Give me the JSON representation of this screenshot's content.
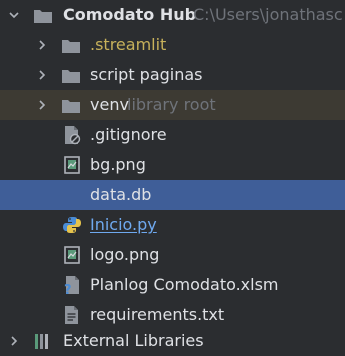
{
  "tree": {
    "root": {
      "name": "Comodato Hub",
      "path": "C:\\Users\\jonathasc"
    },
    "items": [
      {
        "label": ".streamlit",
        "icon": "folder-icon"
      },
      {
        "label": "script paginas",
        "icon": "folder-icon"
      },
      {
        "label": "venv",
        "hint": "library root",
        "icon": "folder-icon"
      },
      {
        "label": ".gitignore",
        "icon": "ignored-file-icon"
      },
      {
        "label": "bg.png",
        "icon": "image-file-icon"
      },
      {
        "label": "data.db",
        "icon": ""
      },
      {
        "label": "Inicio.py",
        "icon": "python-file-icon"
      },
      {
        "label": "logo.png",
        "icon": "image-file-icon"
      },
      {
        "label": "Planlog Comodato.xlsm",
        "icon": "unknown-file-icon"
      },
      {
        "label": "requirements.txt",
        "icon": "text-file-icon"
      }
    ],
    "external": {
      "label": "External Libraries",
      "icon": "library-icon"
    }
  },
  "colors": {
    "background": "#2b2d30",
    "selected": "#3f5e98",
    "venv_highlight": "#3d3a33",
    "folder": "#8f949c",
    "python_link": "#6fa9ef",
    "streamlit_text": "#c7b15b"
  }
}
